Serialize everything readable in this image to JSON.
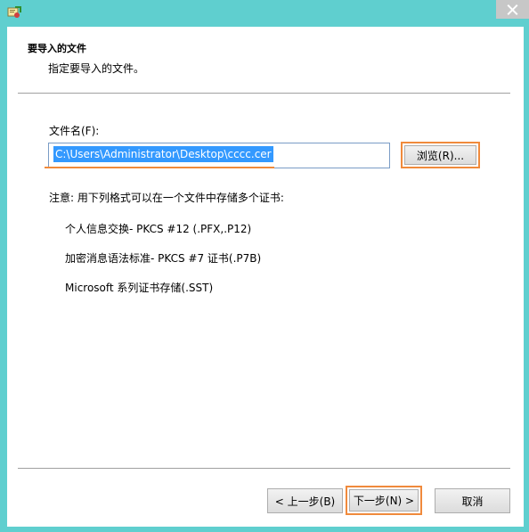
{
  "header": {
    "title": "要导入的文件",
    "subtitle": "指定要导入的文件。"
  },
  "form": {
    "filename_label": "文件名(F):",
    "filename_value": "C:\\Users\\Administrator\\Desktop\\cccc.cer",
    "browse_label": "浏览(R)..."
  },
  "info": {
    "note": "注意: 用下列格式可以在一个文件中存储多个证书:",
    "formats": [
      "个人信息交换- PKCS #12 (.PFX,.P12)",
      "加密消息语法标准- PKCS #7 证书(.P7B)",
      "Microsoft 系列证书存储(.SST)"
    ]
  },
  "footer": {
    "back_label": "< 上一步(B)",
    "next_label": "下一步(N) >",
    "cancel_label": "取消"
  },
  "colors": {
    "frame": "#5fcfcf",
    "highlight": "#f08a3c",
    "selection": "#3399ff"
  },
  "icons": {
    "app": "certificate-import-wizard-icon",
    "close": "close-icon"
  }
}
